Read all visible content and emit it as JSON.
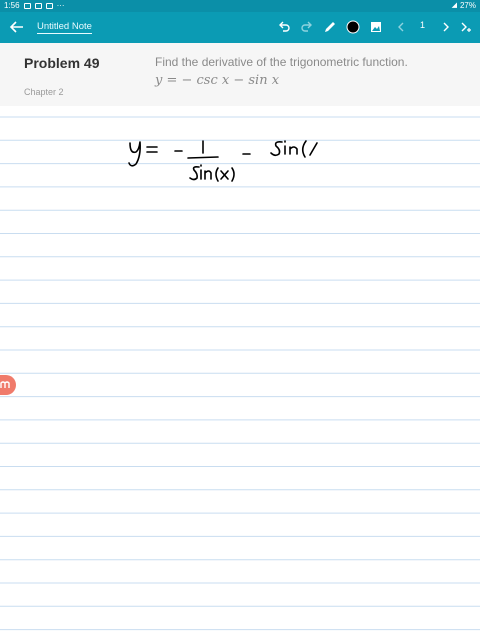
{
  "status": {
    "time": "1:56",
    "dots": "···",
    "battery": "27%"
  },
  "toolbar": {
    "title": "Untitled Note",
    "page_number": "1",
    "icons": [
      "back-arrow-icon",
      "undo-icon",
      "redo-icon",
      "pen-icon",
      "color-dot-icon",
      "image-icon",
      "chevron-left-icon",
      "chevron-right-icon",
      "add-page-icon"
    ]
  },
  "problem": {
    "title": "Problem 49",
    "chapter": "Chapter 2",
    "text": "Find the derivative of the trigonometric function.",
    "equation": "y = − csc x − sin x"
  },
  "colors": {
    "toolbar": "#0b9bb4",
    "statusbar": "#0b8fa8",
    "ruled_line": "#c9ddf0",
    "ink": "#000000",
    "logo": "#f07b6b"
  },
  "handwriting": {
    "strokes_description": "y = - 1/sin(x) - sin(x"
  }
}
